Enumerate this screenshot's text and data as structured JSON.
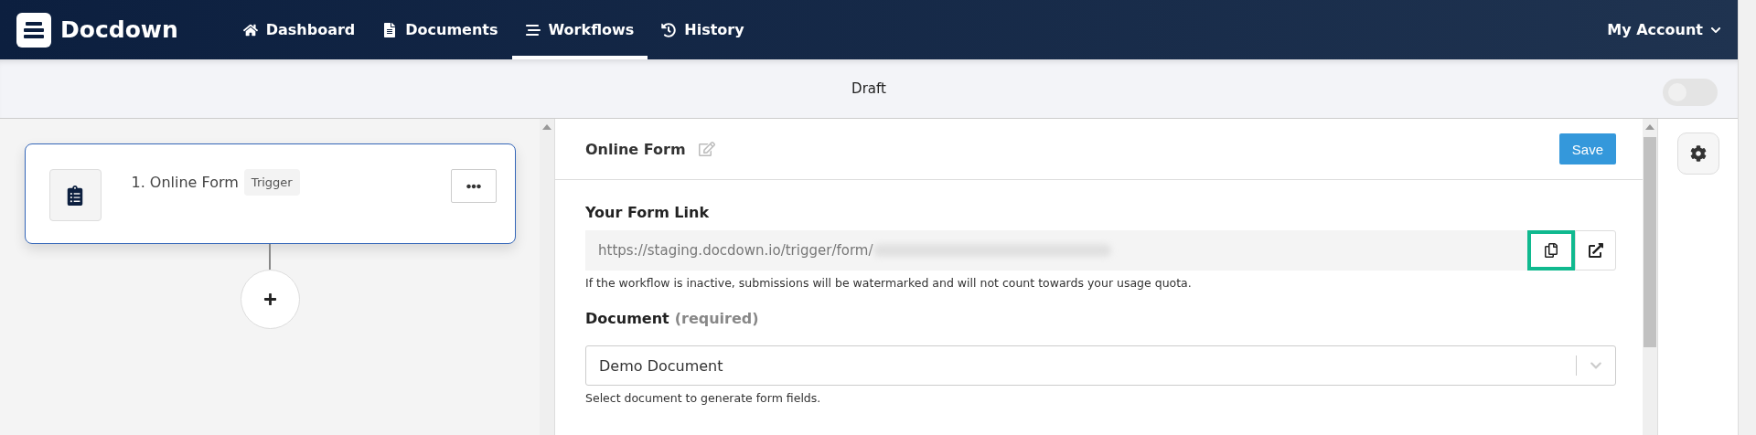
{
  "app": {
    "name": "Docdown"
  },
  "nav": [
    {
      "label": "Dashboard",
      "selected": false
    },
    {
      "label": "Documents",
      "selected": false
    },
    {
      "label": "Workflows",
      "selected": true
    },
    {
      "label": "History",
      "selected": false
    }
  ],
  "account": {
    "label": "My Account"
  },
  "status_bar": {
    "label": "Draft",
    "active_toggle": {
      "on": false
    }
  },
  "workflow": {
    "steps": [
      {
        "title": "1. Online Form",
        "badge": "Trigger",
        "selected": true
      }
    ]
  },
  "panel": {
    "title": "Online Form",
    "save": "Save",
    "form_link": {
      "label": "Your Form Link",
      "value": "https://staging.docdown.io/trigger/form/",
      "copy_highlighted": true,
      "help": "If the workflow is inactive, submissions will be watermarked and will not count towards your usage quota."
    },
    "document": {
      "label": "Document",
      "note": "(required)",
      "value": "Demo Document",
      "help": "Select document to generate form fields."
    }
  }
}
